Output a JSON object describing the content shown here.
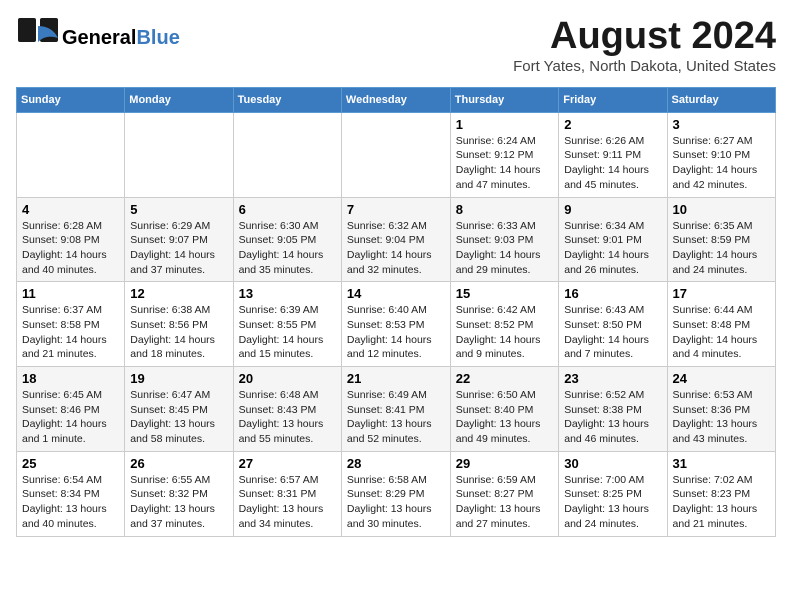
{
  "logo": {
    "line1": "General",
    "line2": "Blue"
  },
  "title": "August 2024",
  "subtitle": "Fort Yates, North Dakota, United States",
  "headers": [
    "Sunday",
    "Monday",
    "Tuesday",
    "Wednesday",
    "Thursday",
    "Friday",
    "Saturday"
  ],
  "weeks": [
    [
      {
        "day": "",
        "content": ""
      },
      {
        "day": "",
        "content": ""
      },
      {
        "day": "",
        "content": ""
      },
      {
        "day": "",
        "content": ""
      },
      {
        "day": "1",
        "content": "Sunrise: 6:24 AM\nSunset: 9:12 PM\nDaylight: 14 hours and 47 minutes."
      },
      {
        "day": "2",
        "content": "Sunrise: 6:26 AM\nSunset: 9:11 PM\nDaylight: 14 hours and 45 minutes."
      },
      {
        "day": "3",
        "content": "Sunrise: 6:27 AM\nSunset: 9:10 PM\nDaylight: 14 hours and 42 minutes."
      }
    ],
    [
      {
        "day": "4",
        "content": "Sunrise: 6:28 AM\nSunset: 9:08 PM\nDaylight: 14 hours and 40 minutes."
      },
      {
        "day": "5",
        "content": "Sunrise: 6:29 AM\nSunset: 9:07 PM\nDaylight: 14 hours and 37 minutes."
      },
      {
        "day": "6",
        "content": "Sunrise: 6:30 AM\nSunset: 9:05 PM\nDaylight: 14 hours and 35 minutes."
      },
      {
        "day": "7",
        "content": "Sunrise: 6:32 AM\nSunset: 9:04 PM\nDaylight: 14 hours and 32 minutes."
      },
      {
        "day": "8",
        "content": "Sunrise: 6:33 AM\nSunset: 9:03 PM\nDaylight: 14 hours and 29 minutes."
      },
      {
        "day": "9",
        "content": "Sunrise: 6:34 AM\nSunset: 9:01 PM\nDaylight: 14 hours and 26 minutes."
      },
      {
        "day": "10",
        "content": "Sunrise: 6:35 AM\nSunset: 8:59 PM\nDaylight: 14 hours and 24 minutes."
      }
    ],
    [
      {
        "day": "11",
        "content": "Sunrise: 6:37 AM\nSunset: 8:58 PM\nDaylight: 14 hours and 21 minutes."
      },
      {
        "day": "12",
        "content": "Sunrise: 6:38 AM\nSunset: 8:56 PM\nDaylight: 14 hours and 18 minutes."
      },
      {
        "day": "13",
        "content": "Sunrise: 6:39 AM\nSunset: 8:55 PM\nDaylight: 14 hours and 15 minutes."
      },
      {
        "day": "14",
        "content": "Sunrise: 6:40 AM\nSunset: 8:53 PM\nDaylight: 14 hours and 12 minutes."
      },
      {
        "day": "15",
        "content": "Sunrise: 6:42 AM\nSunset: 8:52 PM\nDaylight: 14 hours and 9 minutes."
      },
      {
        "day": "16",
        "content": "Sunrise: 6:43 AM\nSunset: 8:50 PM\nDaylight: 14 hours and 7 minutes."
      },
      {
        "day": "17",
        "content": "Sunrise: 6:44 AM\nSunset: 8:48 PM\nDaylight: 14 hours and 4 minutes."
      }
    ],
    [
      {
        "day": "18",
        "content": "Sunrise: 6:45 AM\nSunset: 8:46 PM\nDaylight: 14 hours and 1 minute."
      },
      {
        "day": "19",
        "content": "Sunrise: 6:47 AM\nSunset: 8:45 PM\nDaylight: 13 hours and 58 minutes."
      },
      {
        "day": "20",
        "content": "Sunrise: 6:48 AM\nSunset: 8:43 PM\nDaylight: 13 hours and 55 minutes."
      },
      {
        "day": "21",
        "content": "Sunrise: 6:49 AM\nSunset: 8:41 PM\nDaylight: 13 hours and 52 minutes."
      },
      {
        "day": "22",
        "content": "Sunrise: 6:50 AM\nSunset: 8:40 PM\nDaylight: 13 hours and 49 minutes."
      },
      {
        "day": "23",
        "content": "Sunrise: 6:52 AM\nSunset: 8:38 PM\nDaylight: 13 hours and 46 minutes."
      },
      {
        "day": "24",
        "content": "Sunrise: 6:53 AM\nSunset: 8:36 PM\nDaylight: 13 hours and 43 minutes."
      }
    ],
    [
      {
        "day": "25",
        "content": "Sunrise: 6:54 AM\nSunset: 8:34 PM\nDaylight: 13 hours and 40 minutes."
      },
      {
        "day": "26",
        "content": "Sunrise: 6:55 AM\nSunset: 8:32 PM\nDaylight: 13 hours and 37 minutes."
      },
      {
        "day": "27",
        "content": "Sunrise: 6:57 AM\nSunset: 8:31 PM\nDaylight: 13 hours and 34 minutes."
      },
      {
        "day": "28",
        "content": "Sunrise: 6:58 AM\nSunset: 8:29 PM\nDaylight: 13 hours and 30 minutes."
      },
      {
        "day": "29",
        "content": "Sunrise: 6:59 AM\nSunset: 8:27 PM\nDaylight: 13 hours and 27 minutes."
      },
      {
        "day": "30",
        "content": "Sunrise: 7:00 AM\nSunset: 8:25 PM\nDaylight: 13 hours and 24 minutes."
      },
      {
        "day": "31",
        "content": "Sunrise: 7:02 AM\nSunset: 8:23 PM\nDaylight: 13 hours and 21 minutes."
      }
    ]
  ]
}
